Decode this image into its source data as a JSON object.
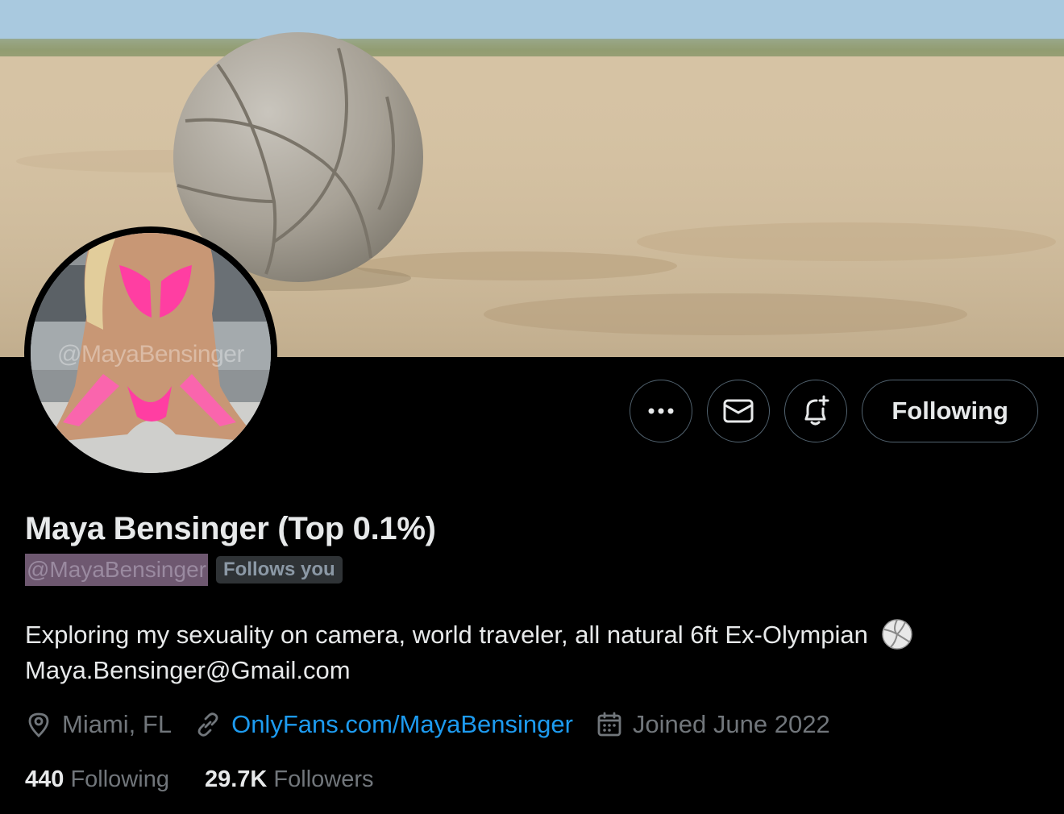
{
  "profile": {
    "display_name": "Maya Bensinger (Top 0.1%)",
    "handle": "@MayaBensinger",
    "follows_you": "Follows you",
    "avatar_watermark": "@MayaBensinger",
    "bio_line1": "Exploring my sexuality on camera, world traveler, all natural 6ft Ex-Olympian",
    "bio_line2": "Maya.Bensinger@Gmail.com",
    "location": "Miami, FL",
    "website": "OnlyFans.com/MayaBensinger",
    "joined": "Joined June 2022"
  },
  "actions": {
    "more_icon": "more-horizontal-icon",
    "message_icon": "envelope-icon",
    "notify_icon": "bell-plus-icon",
    "following_label": "Following"
  },
  "stats": {
    "following_count": "440",
    "following_label": "Following",
    "followers_count": "29.7K",
    "followers_label": "Followers"
  },
  "colors": {
    "background": "#000000",
    "text_primary": "#e7e9ea",
    "text_secondary": "#71767b",
    "link": "#1d9bf0",
    "border": "#536471"
  }
}
